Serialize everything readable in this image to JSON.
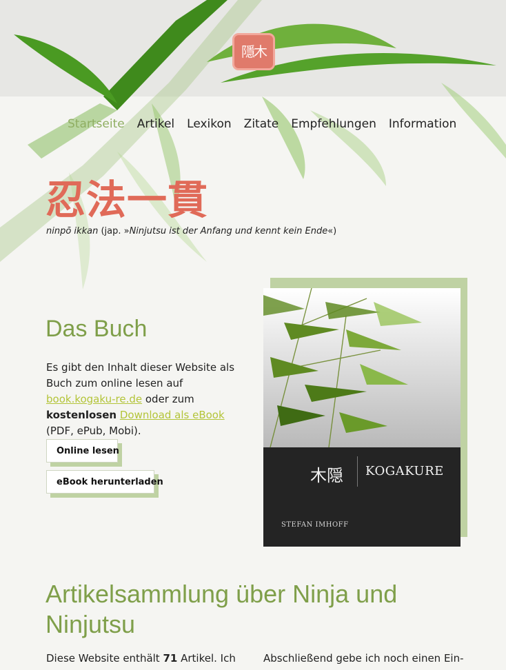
{
  "header": {
    "seal_text": "隱木",
    "nav": [
      {
        "label": "Startseite",
        "active": true
      },
      {
        "label": "Artikel"
      },
      {
        "label": "Lexikon"
      },
      {
        "label": "Zitate"
      },
      {
        "label": "Empfehlungen"
      },
      {
        "label": "Information"
      }
    ]
  },
  "motto": {
    "title": "忍法一貫",
    "romaji": "ninpō ikkan",
    "mid": " (jap. »",
    "translation": "Ninjutsu ist der Anfang und kennt kein Ende",
    "end": "«)"
  },
  "book": {
    "title": "Das Buch",
    "text_1": "Es gibt den Inhalt dieser Website als Buch zum online lesen auf ",
    "link_1": "book.kogaku-re.de",
    "text_2": " oder zum ",
    "bold": "kostenlosen",
    "text_3": " ",
    "link_2": "Download als eBook",
    "text_4": " (PDF, ePub, Mobi).",
    "button_read": "Online lesen",
    "button_download": "eBook herunterladen",
    "cover": {
      "kanji": "木隠",
      "name": "KOGAKURE",
      "author": "STEFAN IMHOFF"
    }
  },
  "articles": {
    "title": "Artikelsammlung über Ninja und Ninjutsu",
    "left_1": "Diese Website enthält ",
    "count": "71",
    "left_2": " Artikel. Ich",
    "right": "Abschließend gebe ich noch einen Ein-"
  },
  "colors": {
    "accent": "#7f9f4a",
    "motto": "#e06a58",
    "link": "#b3c438"
  }
}
